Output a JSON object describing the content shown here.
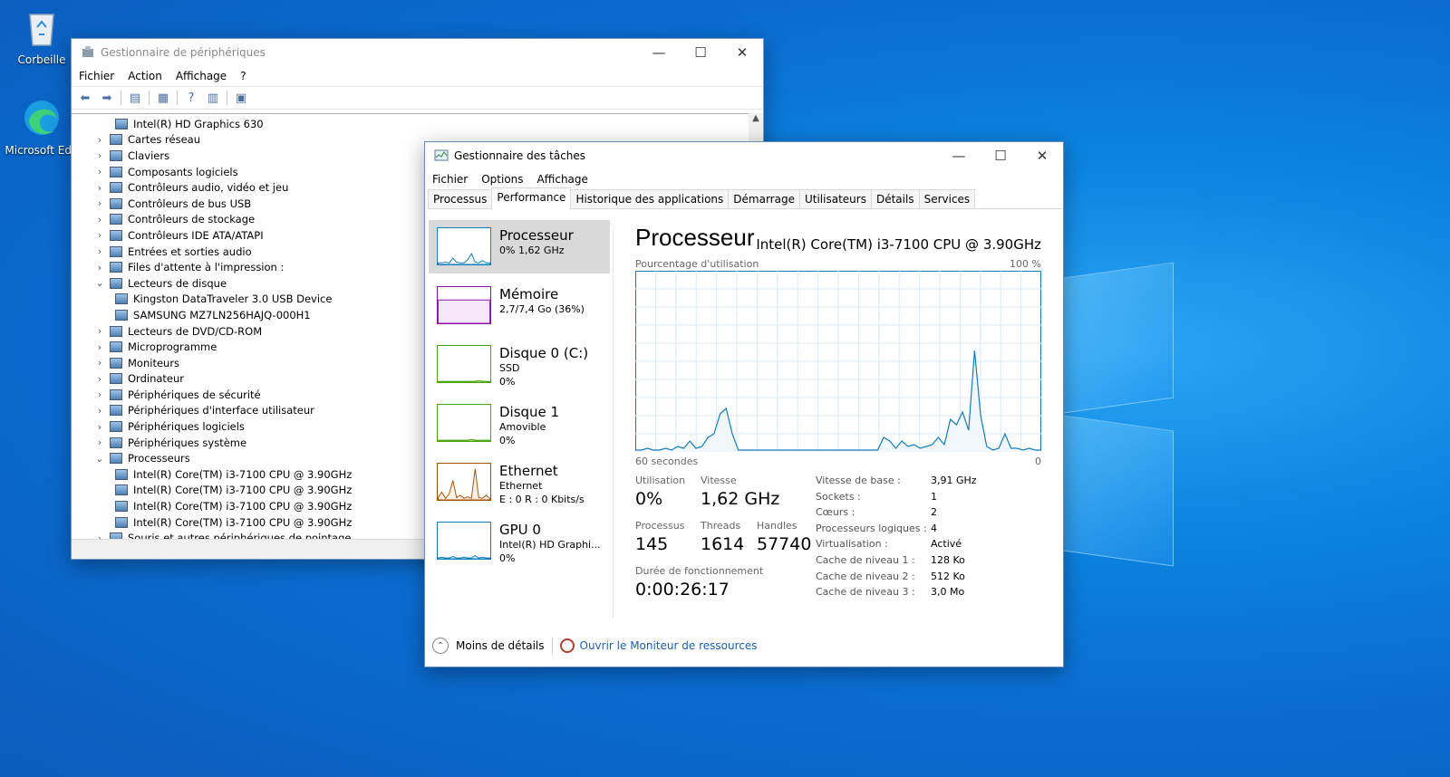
{
  "desktop": {
    "icons": [
      {
        "label": "Corbeille",
        "icon": "recycle-bin-icon"
      },
      {
        "label": "Microsoft Edg",
        "icon": "edge-icon"
      }
    ]
  },
  "devmgr": {
    "title": "Gestionnaire de périphériques",
    "menu": [
      "Fichier",
      "Action",
      "Affichage",
      "?"
    ],
    "tree": [
      {
        "label": "Intel(R) HD Graphics 630",
        "level": 1,
        "arrow": ""
      },
      {
        "label": "Cartes réseau",
        "level": 0,
        "arrow": "›"
      },
      {
        "label": "Claviers",
        "level": 0,
        "arrow": "›"
      },
      {
        "label": "Composants logiciels",
        "level": 0,
        "arrow": "›"
      },
      {
        "label": "Contrôleurs audio, vidéo et jeu",
        "level": 0,
        "arrow": "›"
      },
      {
        "label": "Contrôleurs de bus USB",
        "level": 0,
        "arrow": "›"
      },
      {
        "label": "Contrôleurs de stockage",
        "level": 0,
        "arrow": "›"
      },
      {
        "label": "Contrôleurs IDE ATA/ATAPI",
        "level": 0,
        "arrow": "›"
      },
      {
        "label": "Entrées et sorties audio",
        "level": 0,
        "arrow": "›"
      },
      {
        "label": "Files d'attente à l'impression :",
        "level": 0,
        "arrow": "›"
      },
      {
        "label": "Lecteurs de disque",
        "level": 0,
        "arrow": "⌄"
      },
      {
        "label": "Kingston DataTraveler 3.0 USB Device",
        "level": 1,
        "arrow": ""
      },
      {
        "label": "SAMSUNG MZ7LN256HAJQ-000H1",
        "level": 1,
        "arrow": ""
      },
      {
        "label": "Lecteurs de DVD/CD-ROM",
        "level": 0,
        "arrow": "›"
      },
      {
        "label": "Microprogramme",
        "level": 0,
        "arrow": "›"
      },
      {
        "label": "Moniteurs",
        "level": 0,
        "arrow": "›"
      },
      {
        "label": "Ordinateur",
        "level": 0,
        "arrow": "›"
      },
      {
        "label": "Périphériques de sécurité",
        "level": 0,
        "arrow": "›"
      },
      {
        "label": "Périphériques d'interface utilisateur",
        "level": 0,
        "arrow": "›"
      },
      {
        "label": "Périphériques logiciels",
        "level": 0,
        "arrow": "›"
      },
      {
        "label": "Périphériques système",
        "level": 0,
        "arrow": "›"
      },
      {
        "label": "Processeurs",
        "level": 0,
        "arrow": "⌄"
      },
      {
        "label": "Intel(R) Core(TM) i3-7100 CPU @ 3.90GHz",
        "level": 1,
        "arrow": ""
      },
      {
        "label": "Intel(R) Core(TM) i3-7100 CPU @ 3.90GHz",
        "level": 1,
        "arrow": ""
      },
      {
        "label": "Intel(R) Core(TM) i3-7100 CPU @ 3.90GHz",
        "level": 1,
        "arrow": ""
      },
      {
        "label": "Intel(R) Core(TM) i3-7100 CPU @ 3.90GHz",
        "level": 1,
        "arrow": ""
      },
      {
        "label": "Souris et autres périphériques de pointage",
        "level": 0,
        "arrow": "›"
      }
    ]
  },
  "taskmgr": {
    "title": "Gestionnaire des tâches",
    "menu": [
      "Fichier",
      "Options",
      "Affichage"
    ],
    "tabs": [
      "Processus",
      "Performance",
      "Historique des applications",
      "Démarrage",
      "Utilisateurs",
      "Détails",
      "Services"
    ],
    "active_tab": "Performance",
    "resources": [
      {
        "name": "Processeur",
        "sub": [
          "0% 1,62 GHz"
        ],
        "color": "#117dbb",
        "fill": "#f1f6fa",
        "selected": true
      },
      {
        "name": "Mémoire",
        "sub": [
          "2,7/7,4 Go (36%)"
        ],
        "color": "#8b12ae",
        "fill": "#f4e8f8",
        "selected": false
      },
      {
        "name": "Disque 0 (C:)",
        "sub": [
          "SSD",
          "0%"
        ],
        "color": "#4da60c",
        "fill": "#eff7ea",
        "selected": false
      },
      {
        "name": "Disque 1",
        "sub": [
          "Amovible",
          "0%"
        ],
        "color": "#4da60c",
        "fill": "#eff7ea",
        "selected": false
      },
      {
        "name": "Ethernet",
        "sub": [
          "Ethernet",
          "E : 0 R : 0 Kbits/s"
        ],
        "color": "#a74f01",
        "fill": "#fbf1e8",
        "selected": false
      },
      {
        "name": "GPU 0",
        "sub": [
          "Intel(R) HD Graphi...",
          "0%"
        ],
        "color": "#117dbb",
        "fill": "#f1f6fa",
        "selected": false
      }
    ],
    "perf": {
      "title": "Processeur",
      "cpu_name": "Intel(R) Core(TM) i3-7100 CPU @ 3.90GHz",
      "graph_label": "Pourcentage d'utilisation",
      "graph_max": "100 %",
      "graph_time": "60 secondes",
      "graph_min": "0",
      "stats": {
        "util_label": "Utilisation",
        "util": "0%",
        "speed_label": "Vitesse",
        "speed": "1,62 GHz",
        "proc_label": "Processus",
        "proc": "145",
        "threads_label": "Threads",
        "threads": "1614",
        "handles_label": "Handles",
        "handles": "57740",
        "uptime_label": "Durée de fonctionnement",
        "uptime": "0:00:26:17"
      },
      "specs": [
        {
          "k": "Vitesse de base :",
          "v": "3,91 GHz"
        },
        {
          "k": "Sockets :",
          "v": "1"
        },
        {
          "k": "Cœurs :",
          "v": "2"
        },
        {
          "k": "Processeurs logiques :",
          "v": "4"
        },
        {
          "k": "Virtualisation :",
          "v": "Activé"
        },
        {
          "k": "Cache de niveau 1 :",
          "v": "128 Ko"
        },
        {
          "k": "Cache de niveau 2 :",
          "v": "512 Ko"
        },
        {
          "k": "Cache de niveau 3 :",
          "v": "3,0 Mo"
        }
      ]
    },
    "footer": {
      "less": "Moins de détails",
      "monitor": "Ouvrir le Moniteur de ressources"
    }
  },
  "chart_data": {
    "type": "area",
    "title": "",
    "xlabel": "60 secondes",
    "ylabel": "Pourcentage d'utilisation",
    "ylim": [
      0,
      100
    ],
    "grid": true,
    "series": [
      {
        "values": [
          1,
          1,
          2,
          1,
          1,
          2,
          1,
          3,
          2,
          6,
          2,
          3,
          8,
          10,
          21,
          24,
          10,
          1,
          1,
          1,
          1,
          1,
          1,
          1,
          1,
          1,
          1,
          1,
          1,
          1,
          1,
          1,
          1,
          1,
          1,
          1,
          1,
          1,
          1,
          1,
          1,
          8,
          6,
          2,
          6,
          3,
          4,
          2,
          3,
          4,
          8,
          4,
          18,
          15,
          22,
          12,
          56,
          20,
          3,
          1,
          2,
          10,
          2,
          2,
          1,
          2,
          1,
          1
        ]
      }
    ]
  }
}
